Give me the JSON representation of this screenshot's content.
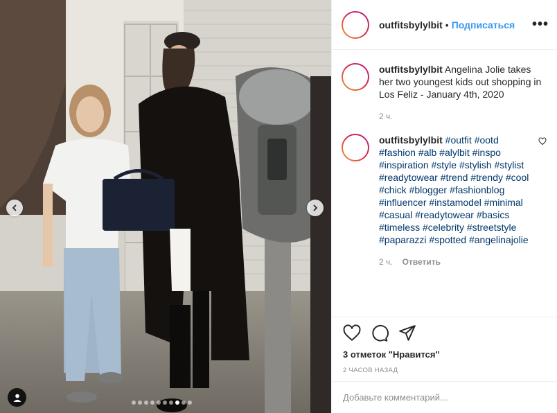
{
  "post": {
    "username": "outfitsbylylbit",
    "separator": "•",
    "follow_label": "Подписаться",
    "more_label": "•••"
  },
  "caption": {
    "username": "outfitsbylylbit",
    "text": "Angelina Jolie takes her two youngest kids out shopping in Los Feliz - January 4th, 2020",
    "time": "2 ч."
  },
  "comment": {
    "username": "outfitsbylylbit",
    "hashtags": "#outfit #ootd #fashion #alb #alylbit #inspo #inspiration #style #stylish #stylist #readytowear #trend #trendy #cool #chick #blogger #fashionblog #influencer #instamodel #minimal #casual #readytowear #basics #timeless #celebrity #streetstyle #paparazzi #spotted #angelinajolie",
    "time": "2 ч.",
    "reply_label": "Ответить"
  },
  "actions": {
    "likes_label": "3 отметок \"Нравится\"",
    "posted_time": "2 часов назад"
  },
  "add_comment": {
    "placeholder": "Добавьте комментарий..."
  },
  "carousel": {
    "slide_count": 10,
    "active_index": 7
  },
  "icons": {
    "like": "heart-icon",
    "comment": "comment-bubble-icon",
    "share": "paper-plane-icon",
    "prev": "chevron-left-icon",
    "next": "chevron-right-icon",
    "tag": "user-tag-icon",
    "comment_like": "small-heart-icon"
  },
  "colors": {
    "accent": "#3897f0",
    "hashtag": "#00376b",
    "muted": "#8e8e8e"
  }
}
